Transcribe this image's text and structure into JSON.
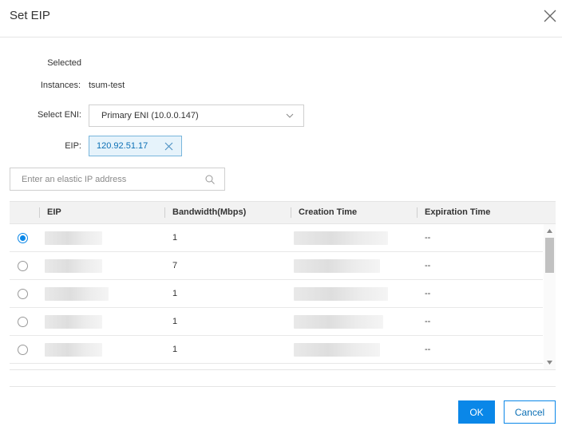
{
  "dialog": {
    "title": "Set EIP"
  },
  "form": {
    "selected_label": "Selected",
    "instances_label": "Instances:",
    "instances_value": "tsum-test",
    "eni_label": "Select ENI:",
    "eni_value": "Primary ENI (10.0.0.147)",
    "eip_label": "EIP:",
    "eip_value": "120.92.51.17"
  },
  "search": {
    "placeholder": "Enter an elastic IP address"
  },
  "table": {
    "columns": [
      "EIP",
      "Bandwidth(Mbps)",
      "Creation Time",
      "Expiration Time"
    ],
    "rows": [
      {
        "selected": true,
        "bandwidth": "1",
        "expiration": "--"
      },
      {
        "selected": false,
        "bandwidth": "7",
        "expiration": "--"
      },
      {
        "selected": false,
        "bandwidth": "1",
        "expiration": "--"
      },
      {
        "selected": false,
        "bandwidth": "1",
        "expiration": "--"
      },
      {
        "selected": false,
        "bandwidth": "1",
        "expiration": "--"
      }
    ]
  },
  "footer": {
    "ok_label": "OK",
    "cancel_label": "Cancel"
  },
  "colors": {
    "accent": "#0a87e8",
    "tag_background": "#e6f3fb"
  },
  "icons": [
    "close-icon",
    "chevron-down-icon",
    "search-icon",
    "scroll-up-icon",
    "scroll-down-icon"
  ]
}
